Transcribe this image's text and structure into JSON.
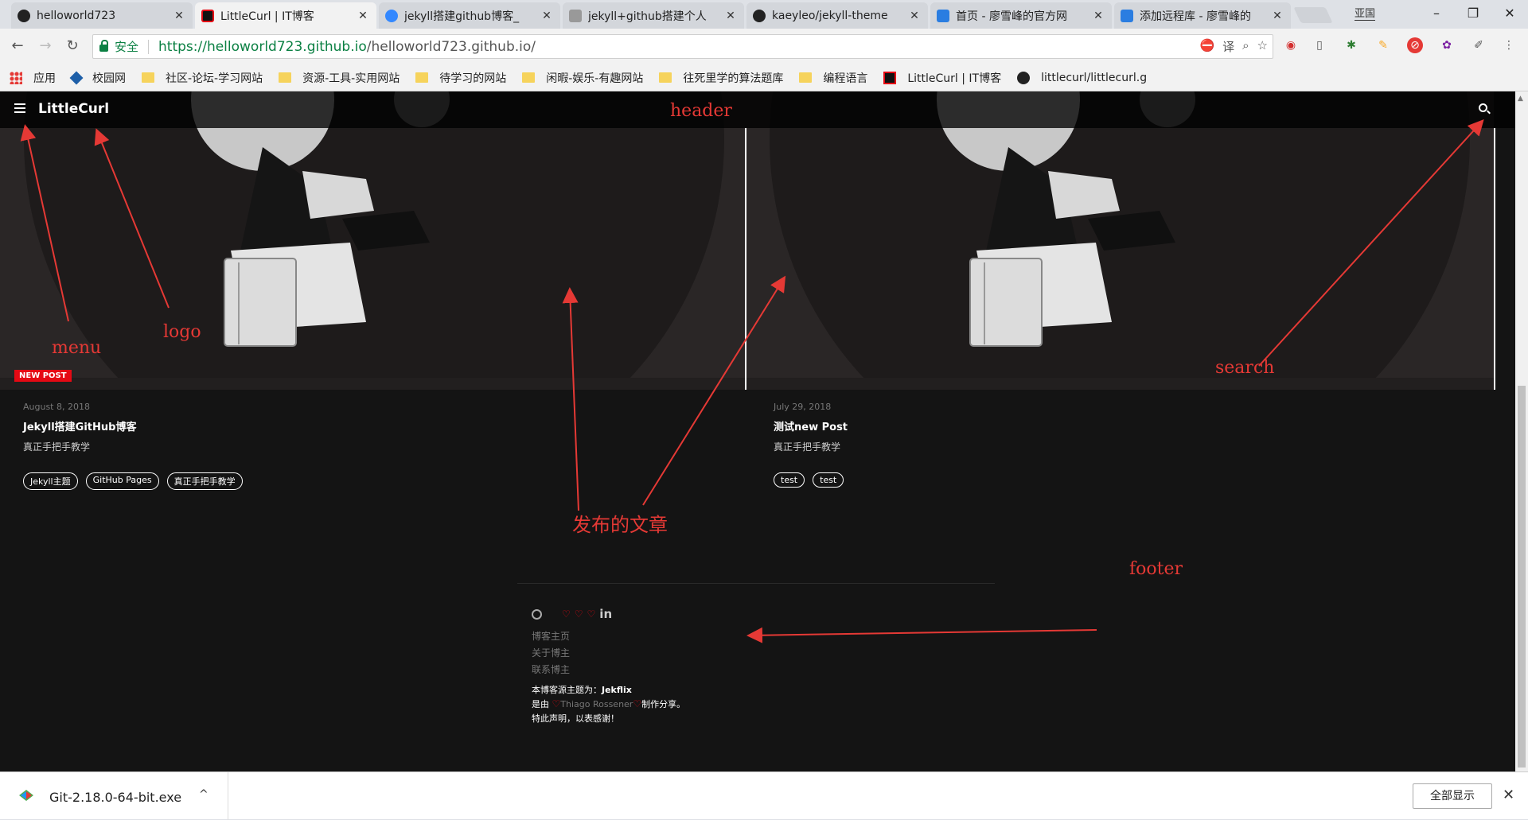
{
  "browser": {
    "tabs": [
      {
        "title": "helloworld723",
        "icon": "github-icon",
        "color": "#222222"
      },
      {
        "title": "LittleCurl | IT博客",
        "icon": "littlecurl-icon",
        "color": "#e50914"
      },
      {
        "title": "jekyll搭建github博客_",
        "icon": "baidu-paw-icon",
        "color": "#3388ff"
      },
      {
        "title": "jekyll+github搭建个人",
        "icon": "feather-icon",
        "color": "#888888"
      },
      {
        "title": "kaeyleo/jekyll-theme",
        "icon": "github-icon",
        "color": "#222222"
      },
      {
        "title": "首页 - 廖雪峰的官方网",
        "icon": "rocket-icon",
        "color": "#2a7de1"
      },
      {
        "title": "添加远程库 - 廖雪峰的",
        "icon": "rocket-icon",
        "color": "#2a7de1"
      }
    ],
    "profile": "亚国",
    "omnibox": {
      "secure_label": "安全",
      "url_host": "https://helloworld723.github.io",
      "url_path": "/helloworld723.github.io/"
    },
    "bookmarks": [
      {
        "label": "应用",
        "icon": "apps-grid-icon"
      },
      {
        "label": "校园网",
        "icon": "campus-icon"
      },
      {
        "label": "社区-论坛-学习网站",
        "icon": "folder-icon"
      },
      {
        "label": "资源-工具-实用网站",
        "icon": "folder-icon"
      },
      {
        "label": "待学习的网站",
        "icon": "folder-icon"
      },
      {
        "label": "闲暇-娱乐-有趣网站",
        "icon": "folder-icon"
      },
      {
        "label": "往死里学的算法题库",
        "icon": "folder-icon"
      },
      {
        "label": "编程语言",
        "icon": "folder-icon"
      },
      {
        "label": "LittleCurl | IT博客",
        "icon": "littlecurl-icon"
      },
      {
        "label": "littlecurl/littlecurl.g",
        "icon": "github-icon"
      }
    ]
  },
  "site": {
    "logo": "LittleCurl",
    "badge": "NEW POST",
    "posts": [
      {
        "date": "August 8, 2018",
        "title": "Jekyll搭建GitHub博客",
        "desc": "真正手把手教学",
        "tags": [
          "Jekyll主题",
          "GitHub Pages",
          "真正手把手教学"
        ]
      },
      {
        "date": "July 29, 2018",
        "title": "测试new Post",
        "desc": "真正手把手教学",
        "tags": [
          "test",
          "test"
        ]
      }
    ],
    "footer": {
      "links": [
        "博客主页",
        "关于博主",
        "联系博主"
      ],
      "theme_prefix": "本博客源主题为：",
      "theme_name": "Jekflix",
      "made_prefix": "是由",
      "author": "Thiago Rossener",
      "made_suffix": "制作分享。",
      "thanks": "特此声明，以表感谢！"
    }
  },
  "annotations": {
    "header": "header",
    "logo": "logo",
    "menu": "menu",
    "search": "search",
    "posts": "发布的文章",
    "footer": "footer"
  },
  "download": {
    "filename": "Git-2.18.0-64-bit.exe",
    "show_all": "全部显示"
  },
  "colors": {
    "accent": "#e50914",
    "annotation": "#e53935",
    "secure": "#0b8043"
  }
}
